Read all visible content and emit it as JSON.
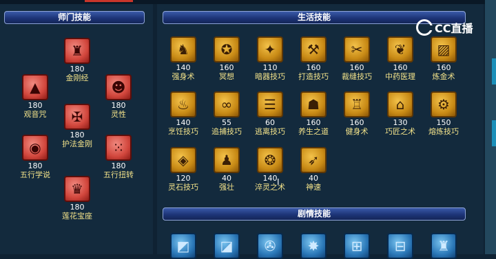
{
  "headers": {
    "school": "师门技能",
    "life": "生活技能",
    "plot": "剧情技能"
  },
  "logo": {
    "text": "CC直播"
  },
  "school_skills": [
    {
      "name": "金刚经",
      "value": "180",
      "glyph": "♜"
    },
    {
      "name": "观音咒",
      "value": "180",
      "glyph": "▲"
    },
    {
      "name": "灵性",
      "value": "180",
      "glyph": "☻"
    },
    {
      "name": "护法金刚",
      "value": "180",
      "glyph": "✠"
    },
    {
      "name": "五行学说",
      "value": "180",
      "glyph": "◉"
    },
    {
      "name": "五行扭转",
      "value": "180",
      "glyph": "⁙"
    },
    {
      "name": "莲花宝座",
      "value": "180",
      "glyph": "♛"
    }
  ],
  "life_skills": [
    {
      "name": "强身术",
      "value": "140",
      "glyph": "♞"
    },
    {
      "name": "冥想",
      "value": "160",
      "glyph": "✪"
    },
    {
      "name": "暗器技巧",
      "value": "110",
      "glyph": "✦"
    },
    {
      "name": "打造技巧",
      "value": "160",
      "glyph": "⚒"
    },
    {
      "name": "裁缝技巧",
      "value": "160",
      "glyph": "✂"
    },
    {
      "name": "中药医理",
      "value": "160",
      "glyph": "❦"
    },
    {
      "name": "炼金术",
      "value": "160",
      "glyph": "▨"
    },
    {
      "name": "烹饪技巧",
      "value": "140",
      "glyph": "♨"
    },
    {
      "name": "追捕技巧",
      "value": "55",
      "glyph": "∞"
    },
    {
      "name": "逃离技巧",
      "value": "60",
      "glyph": "☰"
    },
    {
      "name": "养生之道",
      "value": "160",
      "glyph": "☗"
    },
    {
      "name": "健身术",
      "value": "160",
      "glyph": "♖"
    },
    {
      "name": "巧匠之术",
      "value": "130",
      "glyph": "⌂"
    },
    {
      "name": "熔炼技巧",
      "value": "150",
      "glyph": "⚙"
    },
    {
      "name": "灵石技巧",
      "value": "120",
      "glyph": "◈"
    },
    {
      "name": "强壮",
      "value": "40",
      "glyph": "♟"
    },
    {
      "name": "淬灵之术",
      "value": "140",
      "glyph": "❂"
    },
    {
      "name": "神速",
      "value": "40",
      "glyph": "➶"
    }
  ],
  "plot_skills": [
    {
      "glyph": "◩"
    },
    {
      "glyph": "◪"
    },
    {
      "glyph": "✇"
    },
    {
      "glyph": "✸"
    },
    {
      "glyph": "⊞"
    },
    {
      "glyph": "⊟"
    },
    {
      "glyph": "♜"
    }
  ]
}
